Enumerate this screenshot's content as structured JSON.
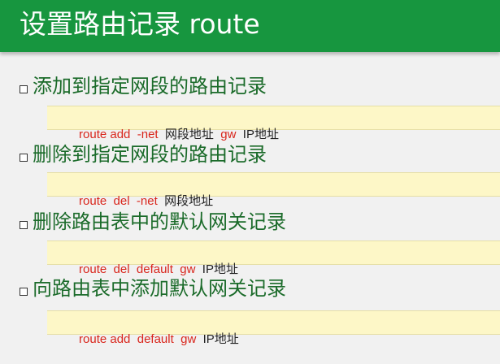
{
  "slide": {
    "title": "设置路由记录 route"
  },
  "items": [
    {
      "heading": "添加到指定网段的路由记录",
      "command": [
        {
          "text": "route add  -net  ",
          "kind": "kw"
        },
        {
          "text": "网段地址  ",
          "kind": "arg"
        },
        {
          "text": "gw  ",
          "kind": "kw"
        },
        {
          "text": "IP地址",
          "kind": "arg"
        }
      ]
    },
    {
      "heading": "删除到指定网段的路由记录",
      "command": [
        {
          "text": "route  del  -net  ",
          "kind": "kw"
        },
        {
          "text": "网段地址",
          "kind": "arg"
        }
      ]
    },
    {
      "heading": "删除路由表中的默认网关记录",
      "command": [
        {
          "text": "route  del  default  gw  ",
          "kind": "kw"
        },
        {
          "text": "IP地址",
          "kind": "arg"
        }
      ]
    },
    {
      "heading": "向路由表中添加默认网关记录",
      "command": [
        {
          "text": "route add  default  gw  ",
          "kind": "kw"
        },
        {
          "text": "IP地址",
          "kind": "arg"
        }
      ]
    }
  ],
  "colors": {
    "title_bar": "#17963f",
    "heading": "#1b6b2a",
    "command_keyword": "#d9261c",
    "command_argument": "#222222",
    "code_background": "#fdf7c7"
  }
}
